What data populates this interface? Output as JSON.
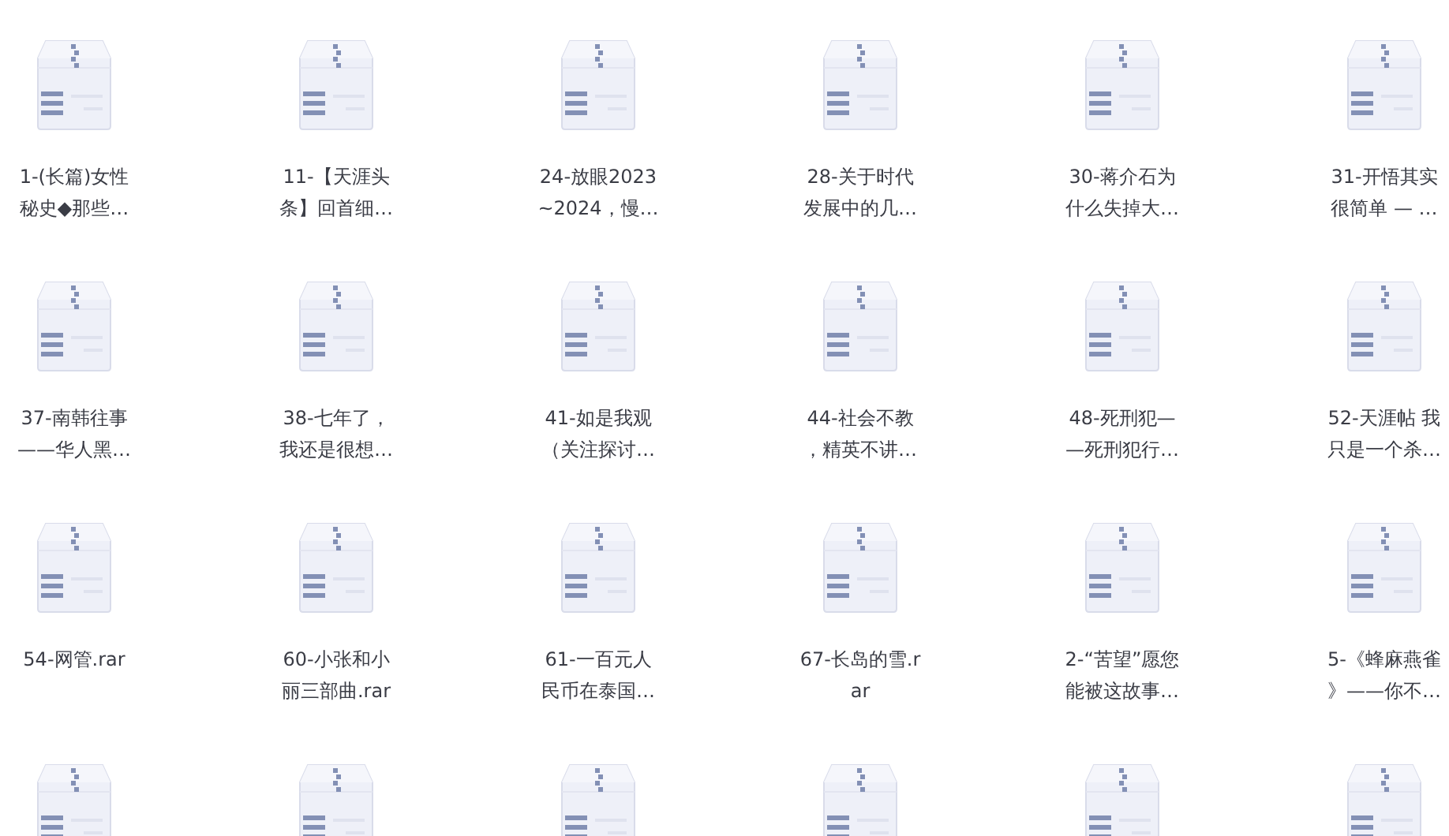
{
  "files": [
    {
      "kind": "archive",
      "name_lines": [
        "1-(长篇)女性",
        "秘史◆那些…"
      ]
    },
    {
      "kind": "archive",
      "name_lines": [
        "11-【天涯头",
        "条】回首细…"
      ]
    },
    {
      "kind": "archive",
      "name_lines": [
        "24-放眼2023",
        "~2024，慢…"
      ]
    },
    {
      "kind": "archive",
      "name_lines": [
        "28-关于时代",
        "发展中的几…"
      ]
    },
    {
      "kind": "archive",
      "name_lines": [
        "30-蒋介石为",
        "什么失掉大…"
      ]
    },
    {
      "kind": "archive",
      "name_lines": [
        "31-开悟其实",
        "很简单 — …"
      ]
    },
    {
      "kind": "archive",
      "name_lines": [
        "37-南韩往事",
        "——华人黑…"
      ]
    },
    {
      "kind": "archive",
      "name_lines": [
        "38-七年了，",
        "我还是很想…"
      ]
    },
    {
      "kind": "archive",
      "name_lines": [
        "41-如是我观",
        "（关注探讨…"
      ]
    },
    {
      "kind": "archive",
      "name_lines": [
        "44-社会不教",
        "，精英不讲…"
      ]
    },
    {
      "kind": "archive",
      "name_lines": [
        "48-死刑犯—",
        "—死刑犯行…"
      ]
    },
    {
      "kind": "archive",
      "name_lines": [
        "52-天涯帖 我",
        "只是一个杀…"
      ]
    },
    {
      "kind": "archive",
      "name_lines": [
        "54-网管.rar"
      ]
    },
    {
      "kind": "archive",
      "name_lines": [
        "60-小张和小",
        "丽三部曲.rar"
      ]
    },
    {
      "kind": "archive",
      "name_lines": [
        "61-一百元人",
        "民币在泰国…"
      ]
    },
    {
      "kind": "archive",
      "name_lines": [
        "67-长岛的雪.r",
        "ar"
      ]
    },
    {
      "kind": "archive",
      "name_lines": [
        "2-“苦望”愿您",
        "能被这故事…"
      ]
    },
    {
      "kind": "archive",
      "name_lines": [
        "5-《蜂麻燕雀",
        "》——你不…"
      ]
    },
    {
      "kind": "archive"
    },
    {
      "kind": "archive"
    },
    {
      "kind": "archive"
    },
    {
      "kind": "archive"
    },
    {
      "kind": "archive"
    },
    {
      "kind": "archive"
    }
  ]
}
